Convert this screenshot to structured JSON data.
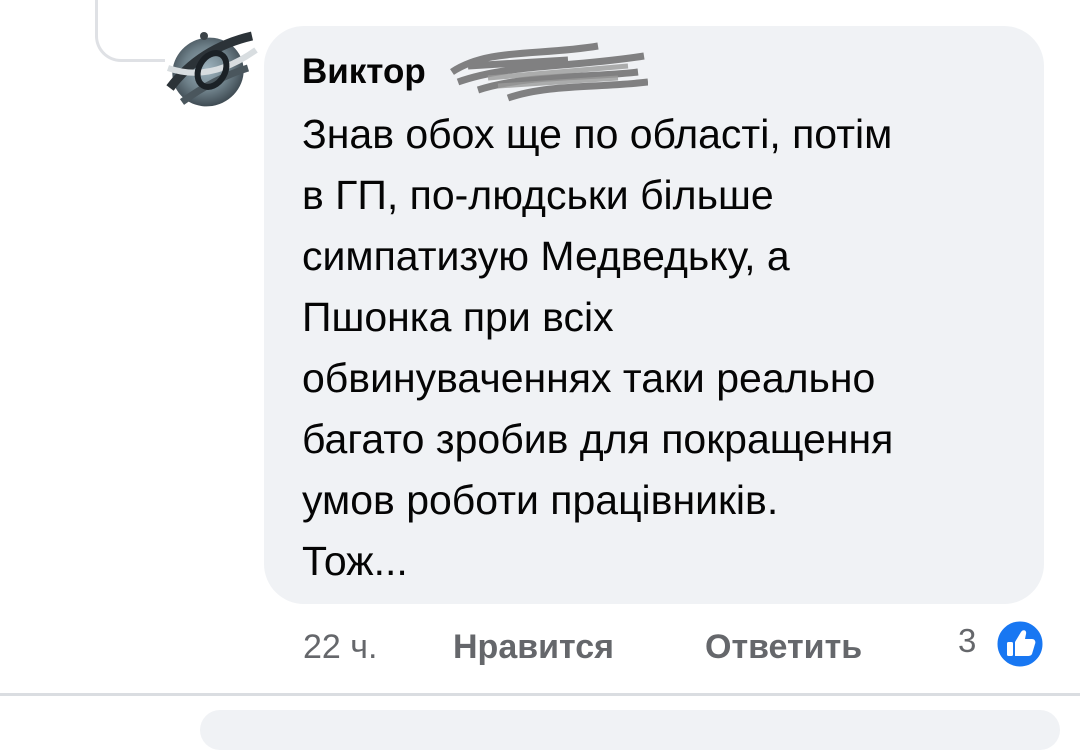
{
  "comment": {
    "author": "Виктор",
    "text": "Знав обох ще по області, потім\nв ГП, по-людськи більше\nсимпатизую Медведьку, а\nПшонка при всіх\nобвинуваченнях таки реально\nбагато зробив для покращення\nумов роботи працівників.\nТож...",
    "time": "22 ч.",
    "like_label": "Нравится",
    "reply_label": "Ответить",
    "reaction_count": "3"
  },
  "icons": {
    "avatar": "avatar-image",
    "redaction": "scribble-redaction",
    "reaction": "like-thumb-icon"
  },
  "colors": {
    "bubble": "#f0f2f5",
    "text": "#050505",
    "meta": "#65676b",
    "like_blue": "#1877f2"
  }
}
